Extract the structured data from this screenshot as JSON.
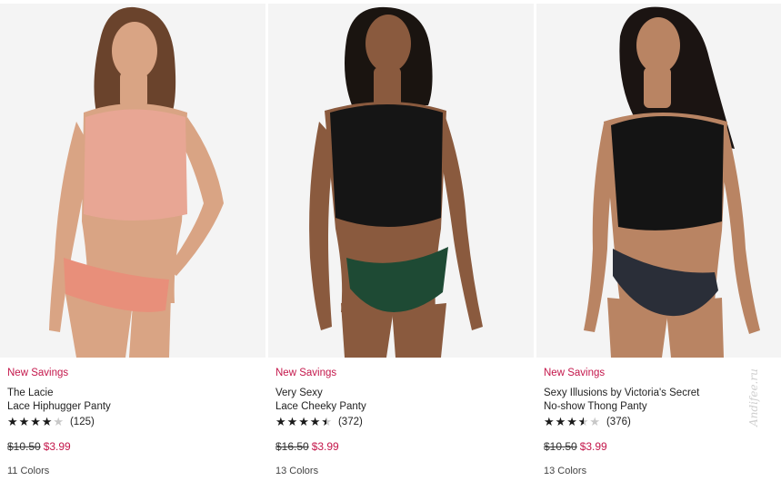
{
  "products": [
    {
      "badge": "New Savings",
      "brand": "The Lacie",
      "name": "Lace Hiphugger Panty",
      "rating": 4,
      "review_count": "(125)",
      "was_price": "$10.50",
      "sale_price": "$3.99",
      "colors": "11 Colors",
      "top_color": "#e8a694",
      "bottom_color": "#e88f7a",
      "skin_color": "#d9a484",
      "hair_color": "#6a432c"
    },
    {
      "badge": "New Savings",
      "brand": "Very Sexy",
      "name": "Lace Cheeky Panty",
      "rating": 4.5,
      "review_count": "(372)",
      "was_price": "$16.50",
      "sale_price": "$3.99",
      "colors": "13 Colors",
      "top_color": "#151515",
      "bottom_color": "#1e4a34",
      "skin_color": "#8a5a3e",
      "hair_color": "#1a1410"
    },
    {
      "badge": "New Savings",
      "brand": "Sexy Illusions by Victoria's Secret",
      "name": "No-show Thong Panty",
      "rating": 3.5,
      "review_count": "(376)",
      "was_price": "$10.50",
      "sale_price": "$3.99",
      "colors": "13 Colors",
      "top_color": "#141414",
      "bottom_color": "#2a2e38",
      "skin_color": "#b98463",
      "hair_color": "#1b1412"
    }
  ],
  "watermark": "Andifee.ru"
}
